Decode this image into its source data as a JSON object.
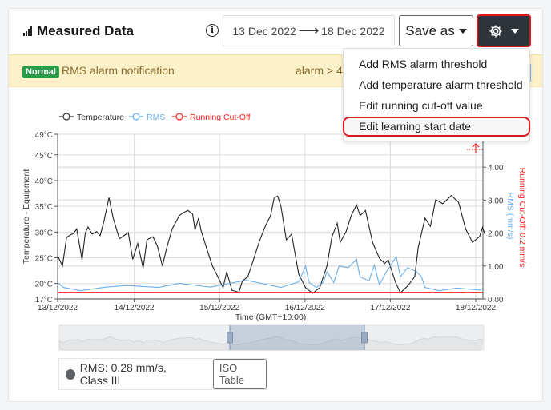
{
  "header": {
    "title": "Measured Data",
    "info_icon": "info-icon",
    "date_from": "13 Dec 2022",
    "date_arrow": "⟶",
    "date_to": "18 Dec 2022",
    "save_as": "Save as",
    "settings_icon": "gear-icon"
  },
  "alert": {
    "badge": "Normal",
    "text": "RMS alarm notification",
    "alarm": "alarm > 4.5",
    "colors": {
      "badge": "#2a9d48",
      "background": "#fdf1c9"
    }
  },
  "menu": {
    "items": [
      {
        "label": "Add RMS alarm threshold"
      },
      {
        "label": "Add temperature alarm threshold"
      },
      {
        "label": "Edit running cut-off value"
      },
      {
        "label": "Edit learning start date",
        "highlighted": true
      }
    ]
  },
  "status": {
    "text": "RMS: 0.28 mm/s, Class III",
    "iso_button": "ISO Table"
  },
  "navigator": {
    "selection_start": "2022-12-15T02:00",
    "selection_end": "2022-12-16T17:45"
  },
  "chart_data": {
    "type": "line",
    "legend": [
      "Temperature",
      "RMS",
      "Running Cut-Off"
    ],
    "legend_placement": "top-left",
    "xlabel": "Time (GMT+10:00)",
    "ylabel_left": "Temperature - Equipment",
    "ylabel_right": "RMS (mm/s)",
    "ylabel_right2": "Running Cut-Off: 0.2 mm/s",
    "x_ticks": [
      "13/12/2022",
      "14/12/2022",
      "15/12/2022",
      "16/12/2022",
      "17/12/2022",
      "18/12/2022"
    ],
    "y_left_ticks": [
      "17°C",
      "20°C",
      "25°C",
      "30°C",
      "35°C",
      "40°C",
      "45°C",
      "49°C"
    ],
    "y_left_range": [
      17,
      49
    ],
    "y_right_ticks": [
      "0.00",
      "1.00",
      "2.00",
      "3.00",
      "4.00"
    ],
    "y_right_range": [
      0,
      5.0
    ],
    "grid": true,
    "colors": {
      "temperature": "#222222",
      "rms": "#6aaee8",
      "cutoff": "#ff2020"
    },
    "cutoff_value": 0.2,
    "series": [
      {
        "name": "Temperature",
        "axis": "left",
        "points": [
          [
            "2022-12-13T02:20",
            25.4
          ],
          [
            "2022-12-13T03:50",
            23.4
          ],
          [
            "2022-12-13T05:00",
            29
          ],
          [
            "2022-12-13T07:00",
            29.8
          ],
          [
            "2022-12-13T07:50",
            30.6
          ],
          [
            "2022-12-13T09:20",
            24.6
          ],
          [
            "2022-12-13T10:15",
            29.8
          ],
          [
            "2022-12-13T11:00",
            31
          ],
          [
            "2022-12-13T12:10",
            29.6
          ],
          [
            "2022-12-13T13:25",
            30.1
          ],
          [
            "2022-12-13T14:25",
            29.3
          ],
          [
            "2022-12-13T15:25",
            31.9
          ],
          [
            "2022-12-13T16:55",
            36.7
          ],
          [
            "2022-12-13T18:05",
            32.7
          ],
          [
            "2022-12-13T19:50",
            28.7
          ],
          [
            "2022-12-13T22:20",
            29.9
          ],
          [
            "2022-12-13T23:35",
            24.7
          ],
          [
            "2022-12-14T01:00",
            27.8
          ],
          [
            "2022-12-14T02:30",
            23
          ],
          [
            "2022-12-14T03:35",
            28.5
          ],
          [
            "2022-12-14T05:15",
            29.1
          ],
          [
            "2022-12-14T06:30",
            27.3
          ],
          [
            "2022-12-14T07:55",
            23.4
          ],
          [
            "2022-12-14T09:10",
            27
          ],
          [
            "2022-12-14T10:40",
            30.6
          ],
          [
            "2022-12-14T12:40",
            33.2
          ],
          [
            "2022-12-14T13:40",
            33.7
          ],
          [
            "2022-12-14T15:05",
            34.2
          ],
          [
            "2022-12-14T16:25",
            33.5
          ],
          [
            "2022-12-14T17:05",
            30.4
          ],
          [
            "2022-12-14T18:05",
            32.7
          ],
          [
            "2022-12-14T18:45",
            30.4
          ],
          [
            "2022-12-14T20:30",
            26.5
          ],
          [
            "2022-12-14T22:00",
            23.4
          ],
          [
            "2022-12-14T23:30",
            21.3
          ],
          [
            "2022-12-15T01:00",
            19.2
          ],
          [
            "2022-12-15T02:00",
            22.3
          ],
          [
            "2022-12-15T03:30",
            18.7
          ],
          [
            "2022-12-15T05:25",
            18.3
          ],
          [
            "2022-12-15T06:25",
            20.5
          ],
          [
            "2022-12-15T07:55",
            21.3
          ],
          [
            "2022-12-15T09:25",
            24.4
          ],
          [
            "2022-12-15T11:20",
            28.5
          ],
          [
            "2022-12-15T12:50",
            31.1
          ],
          [
            "2022-12-15T14:20",
            33.2
          ],
          [
            "2022-12-15T15:20",
            36.6
          ],
          [
            "2022-12-15T16:20",
            37
          ],
          [
            "2022-12-15T17:15",
            35
          ],
          [
            "2022-12-15T18:45",
            28.5
          ],
          [
            "2022-12-15T20:15",
            29.6
          ],
          [
            "2022-12-15T22:15",
            21.8
          ],
          [
            "2022-12-16T00:10",
            19.2
          ],
          [
            "2022-12-16T02:10",
            18.1
          ],
          [
            "2022-12-16T04:10",
            19.2
          ],
          [
            "2022-12-16T06:10",
            23.4
          ],
          [
            "2022-12-16T07:35",
            29.1
          ],
          [
            "2022-12-16T09:05",
            31.7
          ],
          [
            "2022-12-16T09:55",
            28
          ],
          [
            "2022-12-16T11:35",
            30.1
          ],
          [
            "2022-12-16T13:00",
            33.2
          ],
          [
            "2022-12-16T14:30",
            35.3
          ],
          [
            "2022-12-16T15:30",
            33.2
          ],
          [
            "2022-12-16T17:00",
            34.2
          ],
          [
            "2022-12-16T19:00",
            28
          ],
          [
            "2022-12-16T20:55",
            24.9
          ],
          [
            "2022-12-16T22:25",
            23.9
          ],
          [
            "2022-12-16T23:25",
            24.6
          ],
          [
            "2022-12-17T01:25",
            20.3
          ],
          [
            "2022-12-17T02:50",
            18.2
          ],
          [
            "2022-12-17T04:50",
            19.5
          ],
          [
            "2022-12-17T06:50",
            21.3
          ],
          [
            "2022-12-17T07:50",
            27
          ],
          [
            "2022-12-17T09:45",
            32.7
          ],
          [
            "2022-12-17T11:15",
            31.1
          ],
          [
            "2022-12-17T12:45",
            36.3
          ],
          [
            "2022-12-17T14:45",
            35.5
          ],
          [
            "2022-12-17T17:10",
            37.1
          ],
          [
            "2022-12-17T19:10",
            35.8
          ],
          [
            "2022-12-17T21:10",
            30.6
          ],
          [
            "2022-12-17T23:05",
            28
          ],
          [
            "2022-12-18T01:05",
            29.1
          ],
          [
            "2022-12-18T01:55",
            30.9
          ],
          [
            "2022-12-18T02:35",
            29.6
          ]
        ]
      },
      {
        "name": "RMS",
        "axis": "right",
        "points": [
          [
            "2022-12-13T02:20",
            0.5
          ],
          [
            "2022-12-13T04:05",
            0.35
          ],
          [
            "2022-12-13T09:00",
            0.25
          ],
          [
            "2022-12-13T15:55",
            0.36
          ],
          [
            "2022-12-13T21:50",
            0.41
          ],
          [
            "2022-12-14T06:45",
            0.35
          ],
          [
            "2022-12-14T12:40",
            0.47
          ],
          [
            "2022-12-14T21:30",
            0.36
          ],
          [
            "2022-12-15T07:25",
            0.57
          ],
          [
            "2022-12-15T17:15",
            0.35
          ],
          [
            "2022-12-15T22:15",
            0.52
          ],
          [
            "2022-12-16T00:10",
            1.0
          ],
          [
            "2022-12-16T01:10",
            0.5
          ],
          [
            "2022-12-16T03:10",
            0.35
          ],
          [
            "2022-12-16T05:10",
            0.5
          ],
          [
            "2022-12-16T06:10",
            0.83
          ],
          [
            "2022-12-16T08:05",
            0.5
          ],
          [
            "2022-12-16T09:35",
            1.0
          ],
          [
            "2022-12-16T12:05",
            0.95
          ],
          [
            "2022-12-16T14:30",
            1.2
          ],
          [
            "2022-12-16T15:30",
            0.67
          ],
          [
            "2022-12-16T18:00",
            0.55
          ],
          [
            "2022-12-16T19:30",
            1.03
          ],
          [
            "2022-12-16T20:55",
            0.43
          ],
          [
            "2022-12-16T22:55",
            0.83
          ],
          [
            "2022-12-17T01:40",
            1.28
          ],
          [
            "2022-12-17T02:50",
            0.67
          ],
          [
            "2022-12-17T04:50",
            0.95
          ],
          [
            "2022-12-17T07:20",
            0.83
          ],
          [
            "2022-12-17T08:45",
            0.67
          ],
          [
            "2022-12-17T09:45",
            0.35
          ],
          [
            "2022-12-17T13:45",
            0.25
          ],
          [
            "2022-12-17T18:40",
            0.33
          ],
          [
            "2022-12-18T01:35",
            0.27
          ]
        ]
      },
      {
        "name": "Running Cut-Off",
        "axis": "right",
        "points": [
          [
            "2022-12-13T02:20",
            0.2
          ],
          [
            "2022-12-18T02:35",
            0.2
          ]
        ]
      }
    ]
  }
}
